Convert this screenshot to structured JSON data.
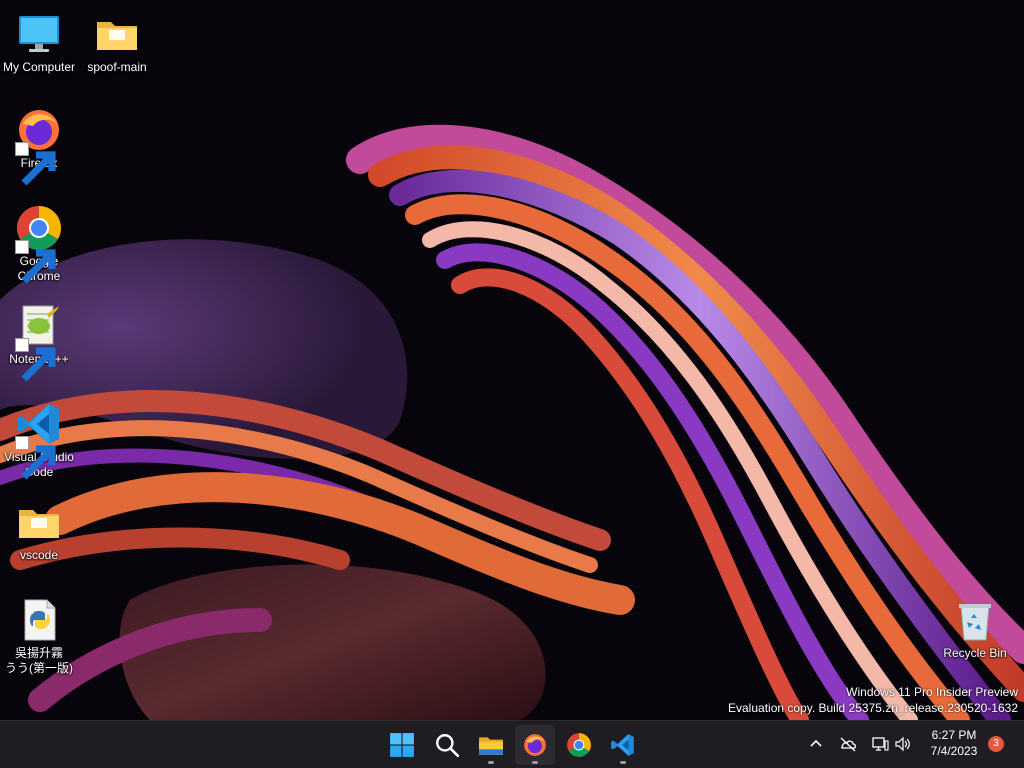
{
  "desktop": {
    "icons": [
      {
        "label": "My Computer",
        "icon": "computer-icon"
      },
      {
        "label": "spoof-main",
        "icon": "folder-icon"
      },
      {
        "label": "Firefox",
        "icon": "firefox-icon"
      },
      {
        "label": "Google\nChrome",
        "icon": "chrome-icon"
      },
      {
        "label": "Notepad++",
        "icon": "notepadpp-icon"
      },
      {
        "label": "Visual Studio\nCode",
        "icon": "vscode-icon"
      },
      {
        "label": "vscode",
        "icon": "folder-icon"
      },
      {
        "label": "吳揚升霧\nうう(第一版)",
        "icon": "python-file-icon"
      },
      {
        "label": "Recycle Bin",
        "icon": "recycle-bin-icon"
      }
    ]
  },
  "watermark": {
    "line1": "Windows 11 Pro Insider Preview",
    "line2": "Evaluation copy. Build 25375.zn_release.230520-1632"
  },
  "taskbar": {
    "apps": [
      "start-icon",
      "search-icon",
      "file-explorer-icon",
      "firefox-icon",
      "chrome-icon",
      "vscode-icon"
    ],
    "tray": [
      "chevron-up-icon",
      "onedrive-offline-icon",
      "network-icon",
      "volume-icon"
    ],
    "clock": {
      "time": "6:27 PM",
      "date": "7/4/2023"
    },
    "notification_count": "3"
  },
  "colors": {
    "taskbar_bg": "#1f1c22",
    "wallpaper_bg": "#07050b",
    "badge": "#e8583f"
  }
}
